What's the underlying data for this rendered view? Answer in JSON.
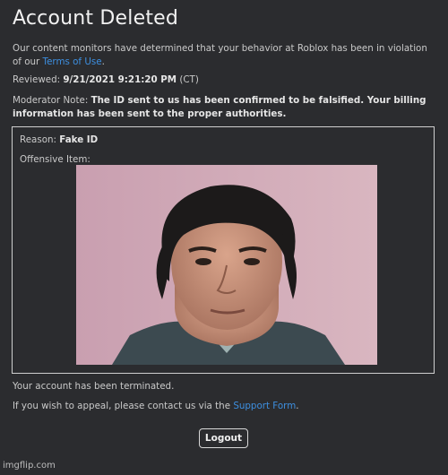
{
  "page": {
    "title": "Account Deleted",
    "intro_text": "Our content monitors have determined that your behavior at Roblox has been in violation",
    "intro_text_2": "of our ",
    "terms_link": "Terms of Use",
    "intro_end": ".",
    "reviewed_label": "Reviewed: ",
    "reviewed_value": "9/21/2021 9:21:20 PM",
    "reviewed_tz": " (CT)",
    "note_label": "Moderator Note: ",
    "note_text_1": "The ID sent to us has been confirmed to be falsified. Your billing",
    "note_text_2": "information has been sent to the proper authorities."
  },
  "details": {
    "reason_label": "Reason: ",
    "reason_value": "Fake ID",
    "offensive_label": "Offensive Item:"
  },
  "footer": {
    "terminated_text": "Your account has been terminated.",
    "appeal_text": "If you wish to appeal, please contact us via the ",
    "support_link": "Support Form",
    "appeal_end": ".",
    "logout_label": "Logout",
    "watermark": "imgflip.com"
  },
  "colors": {
    "background": "#2b2c2f",
    "link": "#3d8fe0",
    "text": "#c9c9c9"
  }
}
